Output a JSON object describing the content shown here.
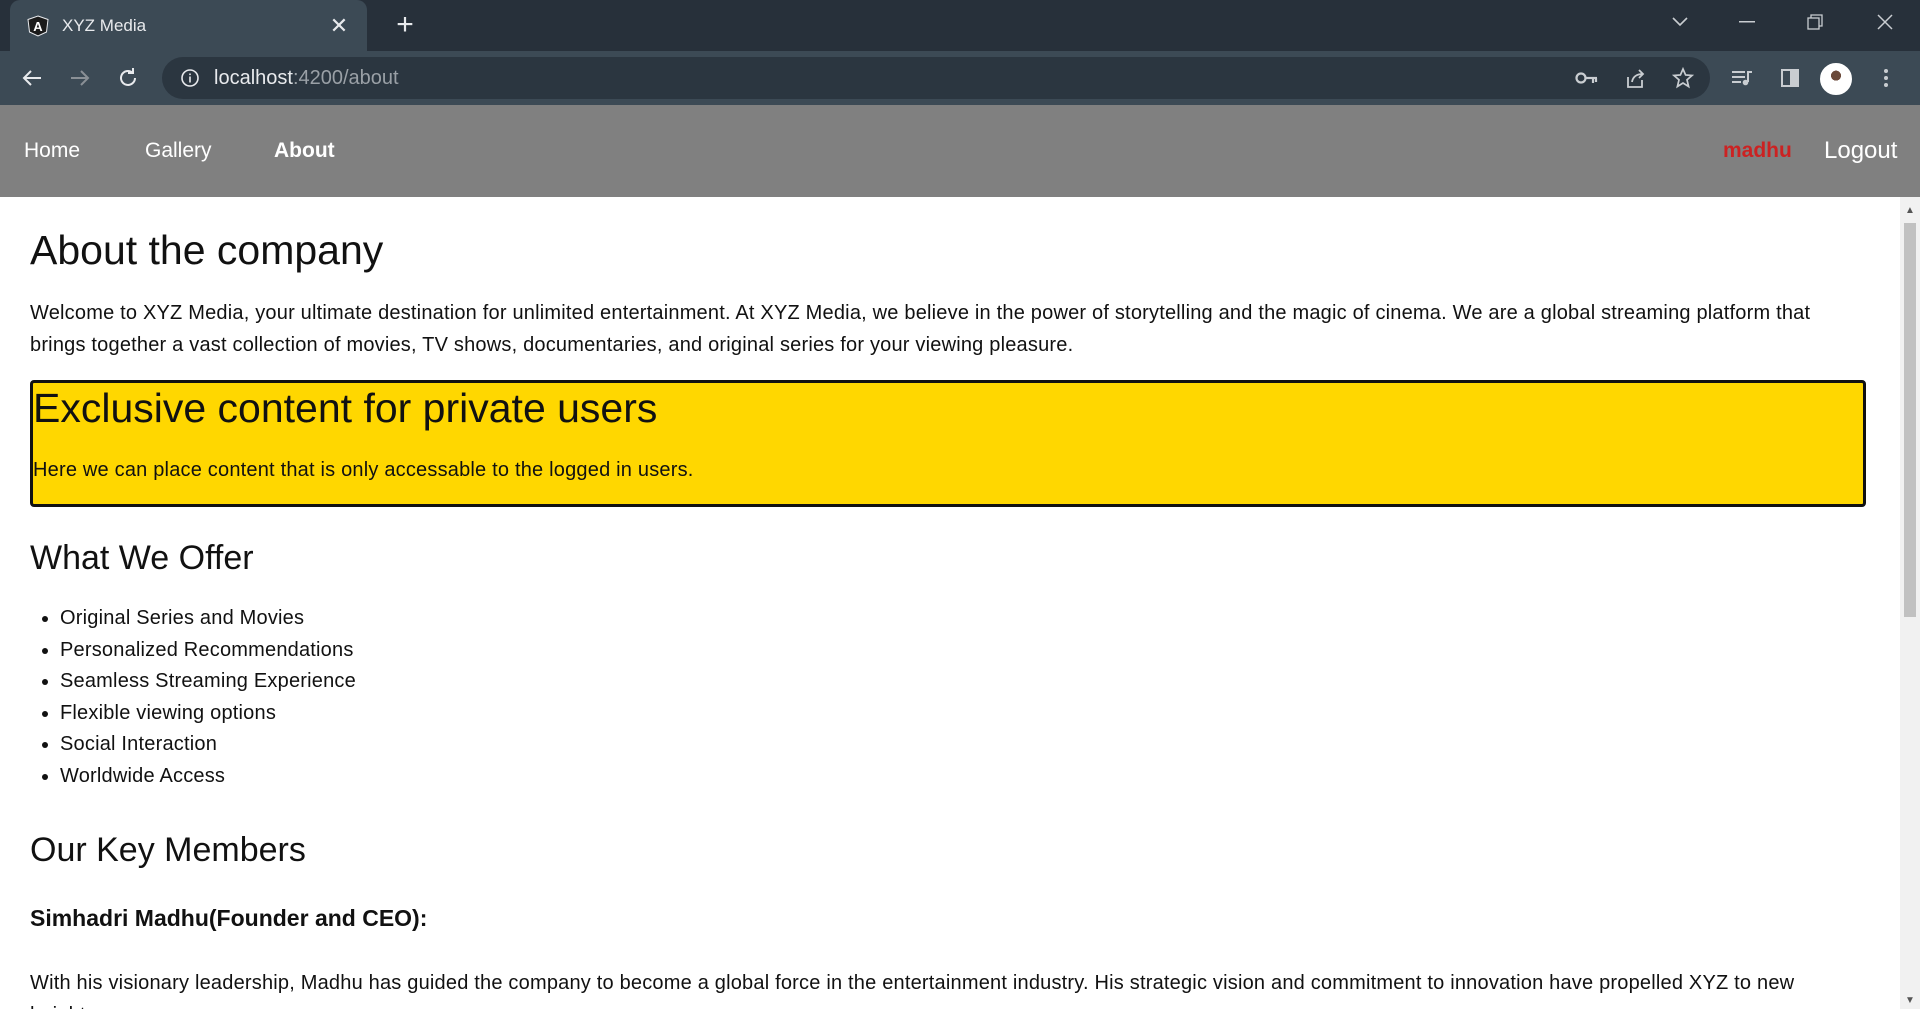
{
  "browser": {
    "tab_title": "XYZ Media",
    "url_host": "localhost",
    "url_path": ":4200/about"
  },
  "nav": {
    "links": [
      "Home",
      "Gallery",
      "About"
    ],
    "active": "About",
    "username": "madhu",
    "logout": "Logout"
  },
  "page": {
    "title": "About the company",
    "intro": "Welcome to XYZ Media, your ultimate destination for unlimited entertainment. At XYZ Media, we believe in the power of storytelling and the magic of cinema. We are a global streaming platform that brings together a vast collection of movies, TV shows, documentaries, and original series for your viewing pleasure.",
    "exclusive": {
      "heading": "Exclusive content for private users",
      "text": "Here we can place content that is only accessable to the logged in users."
    },
    "offer_heading": "What We Offer",
    "offers": [
      "Original Series and Movies",
      "Personalized Recommendations",
      "Seamless Streaming Experience",
      "Flexible viewing options",
      "Social Interaction",
      "Worldwide Access"
    ],
    "members_heading": "Our Key Members",
    "ceo_heading": "Simhadri Madhu(Founder and CEO):",
    "ceo_text": "With his visionary leadership, Madhu has guided the company to become a global force in the entertainment industry. His strategic vision and commitment to innovation have propelled XYZ to new heights."
  },
  "colors": {
    "nav_bg": "#808080",
    "username": "#cc2222",
    "exclusive_bg": "#ffd700"
  }
}
